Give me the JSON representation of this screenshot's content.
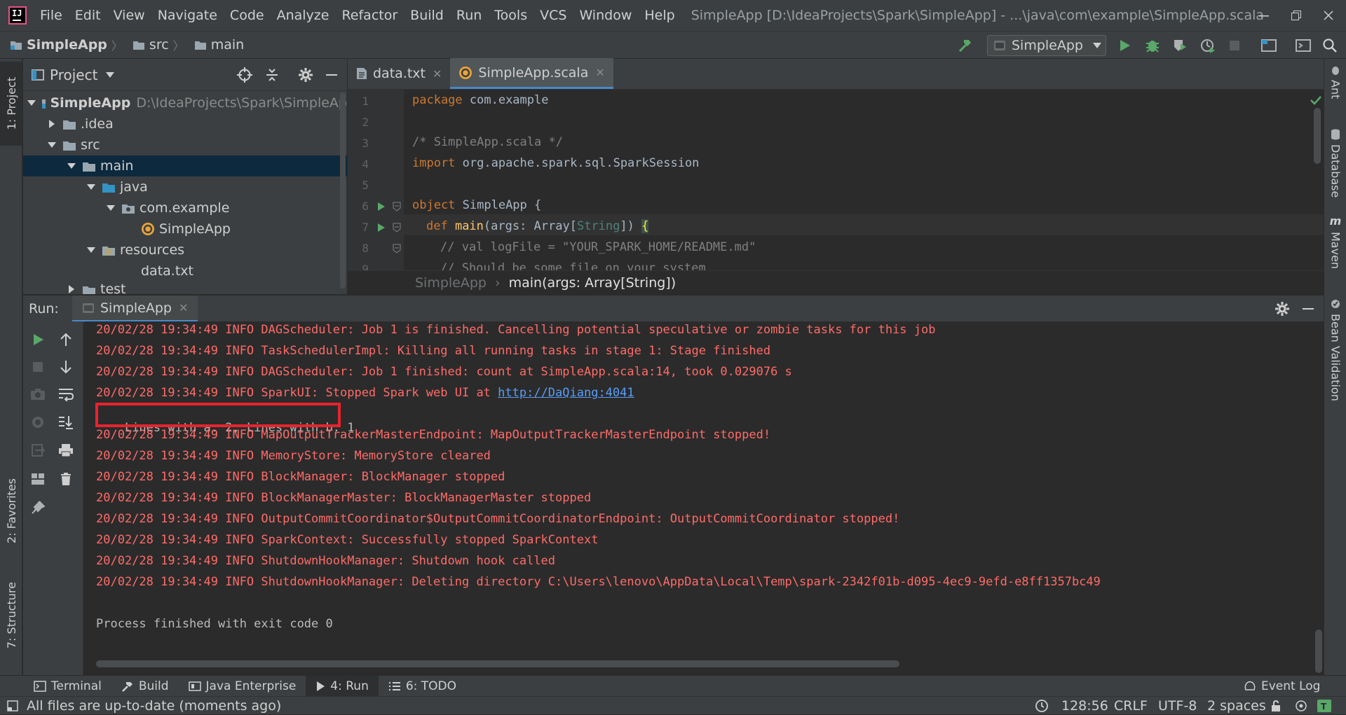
{
  "menu": [
    "File",
    "Edit",
    "View",
    "Navigate",
    "Code",
    "Analyze",
    "Refactor",
    "Build",
    "Run",
    "Tools",
    "VCS",
    "Window",
    "Help"
  ],
  "window_title": "SimpleApp [D:\\IdeaProjects\\Spark\\SimpleApp] - ...\\java\\com\\example\\SimpleApp.scala",
  "navbar": {
    "crumbs": [
      "SimpleApp",
      "src",
      "main"
    ],
    "run_config": "SimpleApp"
  },
  "left_stripe": {
    "project": "1: Project",
    "favorites": "2: Favorites",
    "structure": "7: Structure"
  },
  "right_stripe": [
    "Ant",
    "Database",
    "Maven",
    "Bean Validation"
  ],
  "project_panel": {
    "title": "Project",
    "tree": [
      {
        "label": "SimpleApp",
        "hint": "D:\\IdeaProjects\\Spark\\SimpleAp"
      },
      {
        "label": ".idea"
      },
      {
        "label": "src"
      },
      {
        "label": "main"
      },
      {
        "label": "java"
      },
      {
        "label": "com.example"
      },
      {
        "label": "SimpleApp"
      },
      {
        "label": "resources"
      },
      {
        "label": "data.txt"
      },
      {
        "label": "test"
      }
    ]
  },
  "editor": {
    "tabs": [
      {
        "label": "data.txt"
      },
      {
        "label": "SimpleApp.scala"
      }
    ],
    "line_numbers": [
      "1",
      "2",
      "3",
      "4",
      "5",
      "6",
      "7",
      "8",
      "9"
    ],
    "code": {
      "l1_kw": "package",
      "l1_rest": " com.example",
      "l3": "/* SimpleApp.scala */",
      "l4_kw": "import",
      "l4_rest": " org.apache.spark.sql.SparkSession",
      "l6_kw": "object",
      "l6_rest": " SimpleApp {",
      "l7_kw": "def",
      "l7_fn": " main",
      "l7_a": "(args: Array[",
      "l7_ty": "String",
      "l7_b": "]) ",
      "l7_brace": "{",
      "l8": "// val logFile = \"YOUR_SPARK_HOME/README.md\"",
      "l9": "// Should be some file on your system"
    },
    "breadcrumb": [
      "SimpleApp",
      "main(args: Array[String])"
    ]
  },
  "run_panel": {
    "label": "Run:",
    "tab": "SimpleApp",
    "lines": [
      "20/02/28 19:34:49 INFO DAGScheduler: Job 1 is finished. Cancelling potential speculative or zombie tasks for this job",
      "20/02/28 19:34:49 INFO TaskSchedulerImpl: Killing all running tasks in stage 1: Stage finished",
      "20/02/28 19:34:49 INFO DAGScheduler: Job 1 finished: count at SimpleApp.scala:14, took 0.029076 s",
      "20/02/28 19:34:49 INFO SparkUI: Stopped Spark web UI at ",
      "Lines with a: 2, Lines with b: 1",
      "20/02/28 19:34:49 INFO MapOutputTrackerMasterEndpoint: MapOutputTrackerMasterEndpoint stopped!",
      "20/02/28 19:34:49 INFO MemoryStore: MemoryStore cleared",
      "20/02/28 19:34:49 INFO BlockManager: BlockManager stopped",
      "20/02/28 19:34:49 INFO BlockManagerMaster: BlockManagerMaster stopped",
      "20/02/28 19:34:49 INFO OutputCommitCoordinator$OutputCommitCoordinatorEndpoint: OutputCommitCoordinator stopped!",
      "20/02/28 19:34:49 INFO SparkContext: Successfully stopped SparkContext",
      "20/02/28 19:34:49 INFO ShutdownHookManager: Shutdown hook called",
      "20/02/28 19:34:49 INFO ShutdownHookManager: Deleting directory C:\\Users\\lenovo\\AppData\\Local\\Temp\\spark-2342f01b-d095-4ec9-9efd-e8ff1357bc49",
      "",
      "Process finished with exit code 0"
    ],
    "link": "http://DaQiang:4041"
  },
  "bottom_tabs": [
    {
      "label": "Terminal"
    },
    {
      "label": "Build"
    },
    {
      "label": "Java Enterprise"
    },
    {
      "label": "4: Run"
    },
    {
      "label": "6: TODO"
    }
  ],
  "event_log": "Event Log",
  "status": {
    "message": "All files are up-to-date (moments ago)",
    "position": "128:56",
    "line_sep": "CRLF",
    "encoding": "UTF-8",
    "indent": "2 spaces"
  },
  "colors": {
    "error_text": "#ff6b68",
    "accent": "#4a88c7",
    "highlight_box": "#e8232e",
    "run_green": "#59a869"
  },
  "icons": [
    "app-logo",
    "folder-icon",
    "run-icon",
    "debug-icon",
    "coverage-icon",
    "profile-icon",
    "stop-icon",
    "build-hammer-icon",
    "search-icon",
    "gear-icon",
    "crosshair-icon",
    "collapse-icon",
    "minimize-icon",
    "scala-object-icon",
    "text-file-icon",
    "close-icon",
    "up-arrow-icon",
    "down-arrow-icon",
    "wrap-icon",
    "scroll-end-icon",
    "print-icon",
    "trash-icon",
    "camera-icon",
    "pin-icon",
    "layout-icon",
    "exit-icon",
    "clock-icon",
    "lock-icon",
    "checkmark-icon"
  ]
}
